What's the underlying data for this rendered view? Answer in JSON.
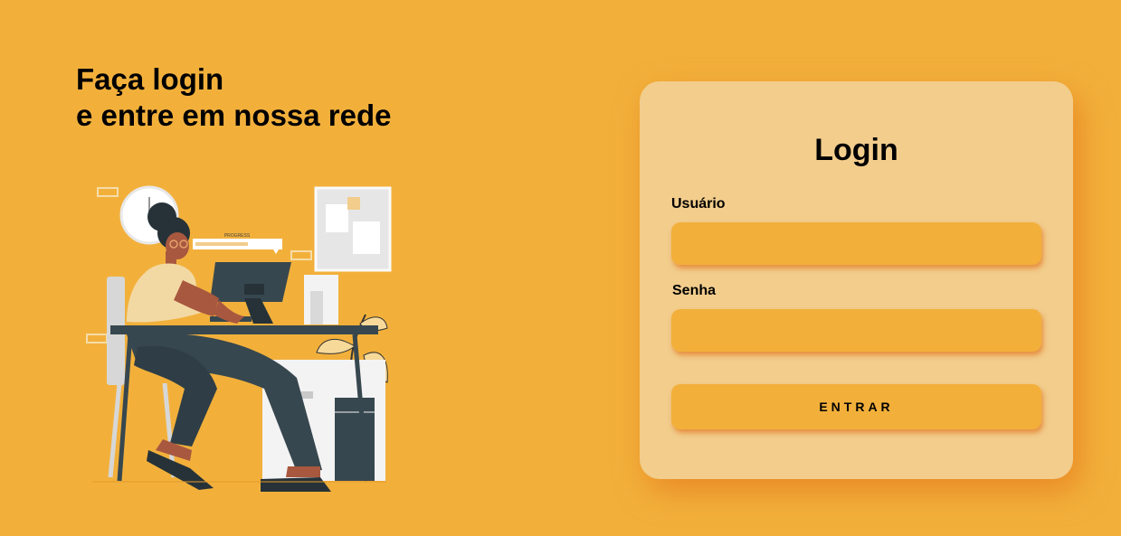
{
  "hero": {
    "headline_line1": "Faça login",
    "headline_line2": "e entre em nossa rede",
    "illustration": {
      "description_icon": "woman-working-at-computer-illustration",
      "progress_label": "PROGRESS"
    }
  },
  "login_card": {
    "title": "Login",
    "username_label": "Usuário",
    "username_value": "",
    "password_label": "Senha",
    "password_value": "",
    "submit_label": "ENTRAR"
  },
  "colors": {
    "background": "#f2b03b",
    "card": "#f2cd8c",
    "input": "#f2b03b",
    "shadow": "#e06e18",
    "text": "#000000"
  }
}
